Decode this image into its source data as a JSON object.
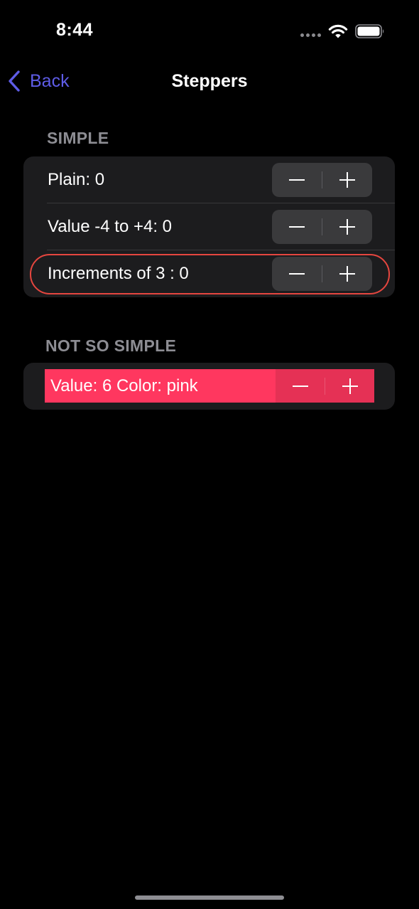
{
  "status_bar": {
    "time": "8:44",
    "icons": [
      "cellular-dots-icon",
      "wifi-icon",
      "battery-icon"
    ]
  },
  "nav": {
    "back_label": "Back",
    "title": "Steppers",
    "accent_color": "#5e5ce6"
  },
  "sections": {
    "simple": {
      "header": "SIMPLE",
      "rows": [
        {
          "label": "Plain: 0"
        },
        {
          "label": "Value -4 to +4: 0"
        },
        {
          "label": "Increments of 3 : 0"
        }
      ]
    },
    "not_so_simple": {
      "header": "NOT SO SIMPLE",
      "rows": [
        {
          "label": "Value: 6 Color: pink",
          "background": "#ff375f"
        }
      ]
    }
  },
  "colors": {
    "background": "#000000",
    "group_background": "#1c1c1e",
    "stepper_background": "#3a3a3c",
    "focus_ring": "#e5463f",
    "pink": "#ff375f"
  }
}
